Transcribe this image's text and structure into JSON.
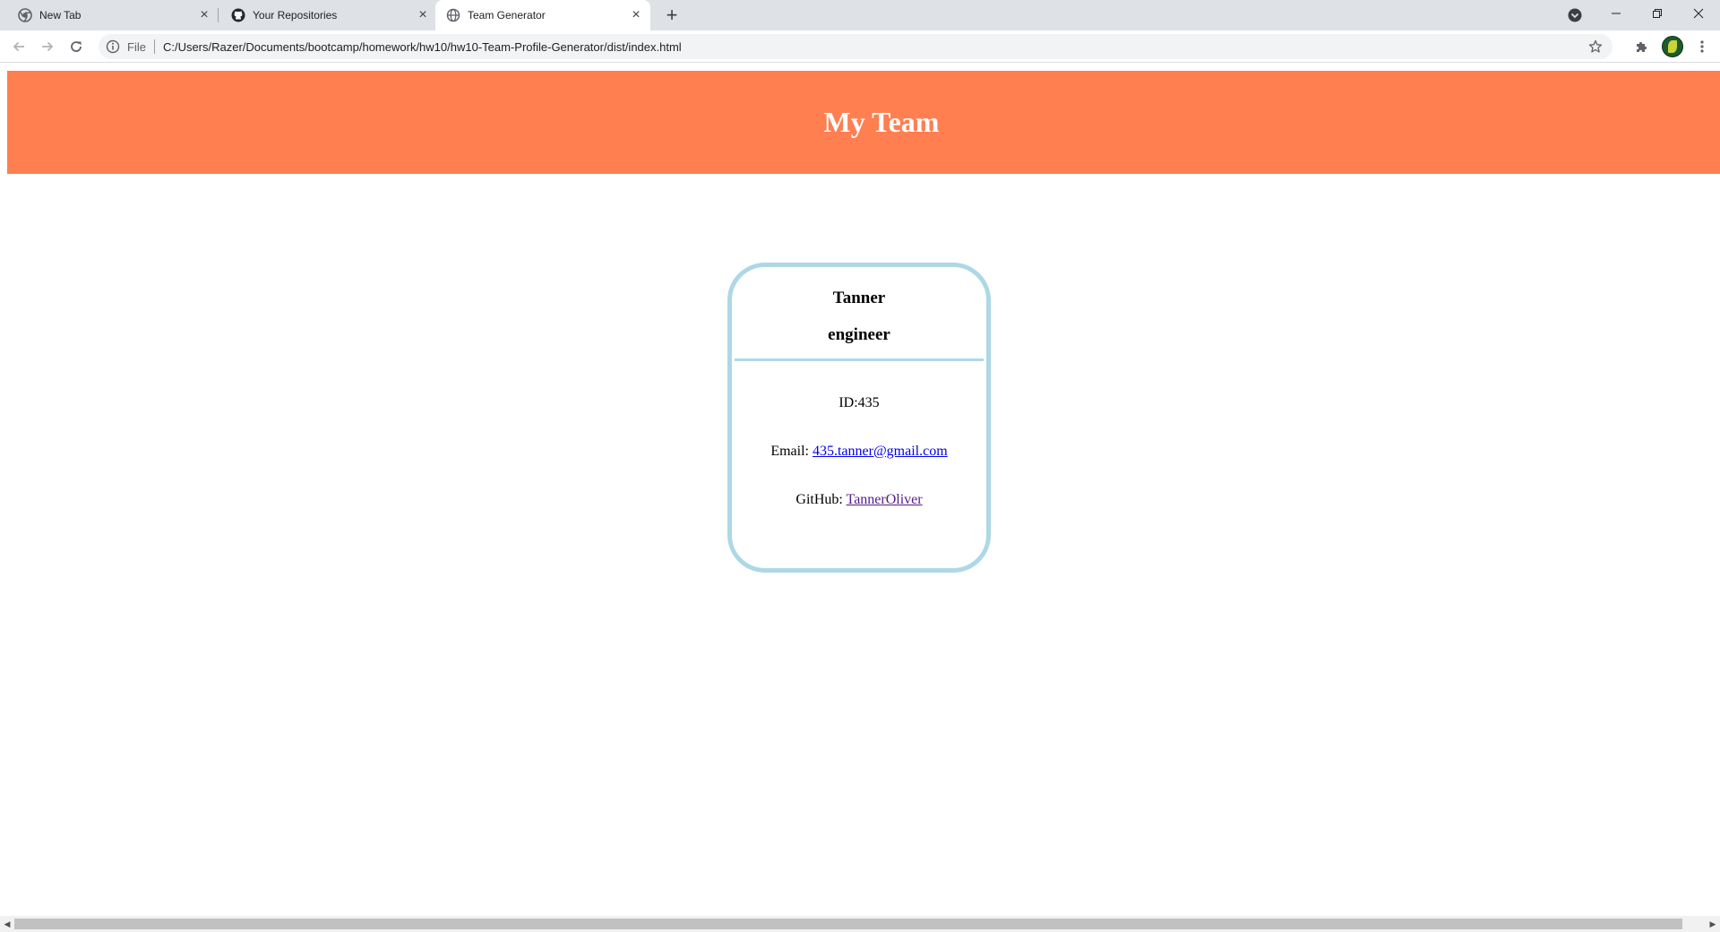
{
  "browser": {
    "tabs": [
      {
        "title": "New Tab",
        "icon": "chrome-icon",
        "active": false
      },
      {
        "title": "Your Repositories",
        "icon": "github-icon",
        "active": false
      },
      {
        "title": "Team Generator",
        "icon": "globe-icon",
        "active": true
      }
    ],
    "new_tab_label": "+",
    "address_scheme_label": "File",
    "url": "C:/Users/Razer/Documents/bootcamp/homework/hw10/hw10-Team-Profile-Generator/dist/index.html"
  },
  "page": {
    "title": "My Team",
    "header_color": "#ff7f50",
    "card_border_color": "#add8e6",
    "card": {
      "name": "Tanner",
      "role": "engineer",
      "id_text": "ID:435",
      "email_label": "Email: ",
      "email": "435.tanner@gmail.com",
      "github_label": "GitHub: ",
      "github": "TannerOliver"
    }
  }
}
